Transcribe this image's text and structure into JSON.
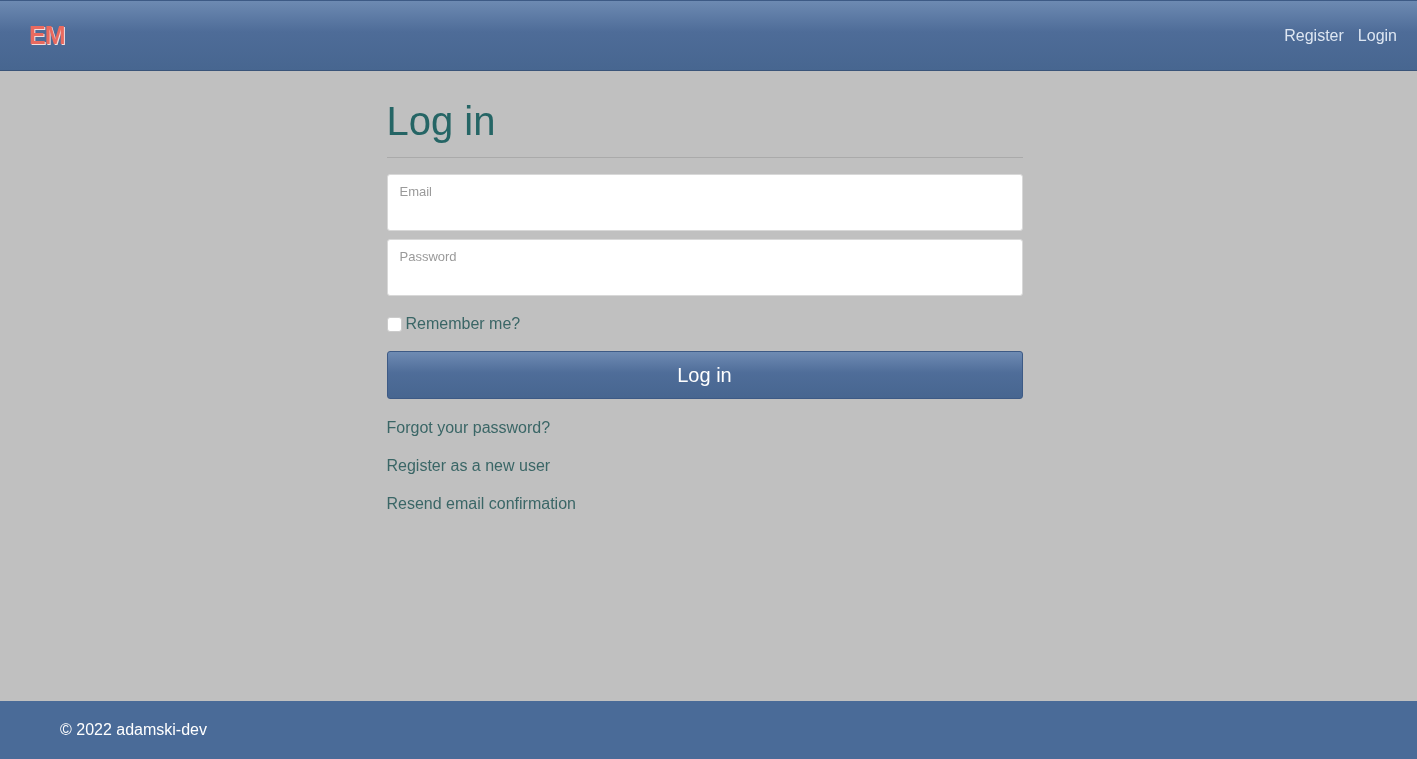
{
  "navbar": {
    "brand": "EM",
    "links": [
      "Register",
      "Login"
    ]
  },
  "form": {
    "title": "Log in",
    "fields": [
      {
        "placeholder": "Email"
      },
      {
        "placeholder": "Password"
      }
    ],
    "remember": {
      "label": "Remember me?",
      "checked": false
    },
    "submit": "Log in",
    "links": [
      "Forgot your password?",
      "Register as a new user",
      "Resend email confirmation"
    ]
  },
  "footer": {
    "text": "© 2022 adamski-dev"
  }
}
